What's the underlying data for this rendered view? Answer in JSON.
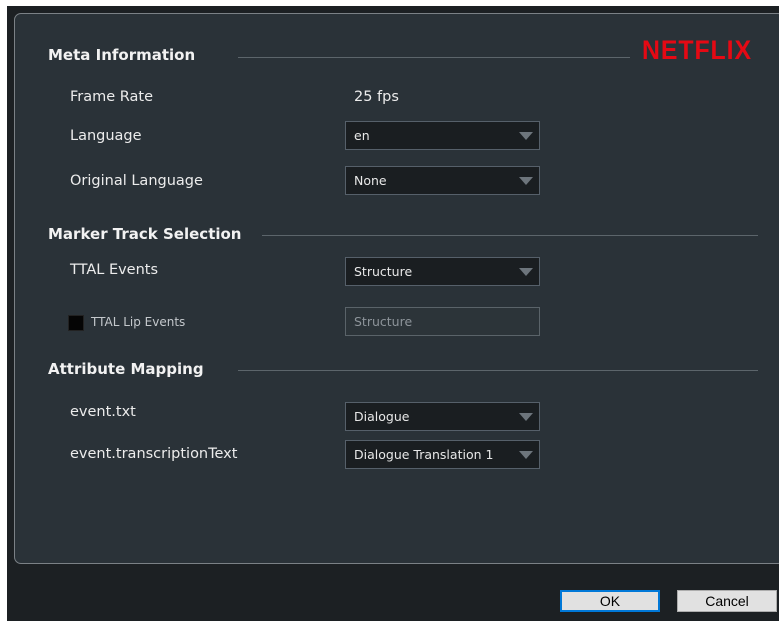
{
  "brand": {
    "logo_text": "NETFLIX",
    "logo_color": "#e50914"
  },
  "meta": {
    "title": "Meta Information",
    "frame_rate": {
      "label": "Frame Rate",
      "value": "25 fps"
    },
    "language": {
      "label": "Language",
      "value": "en"
    },
    "original_language": {
      "label": "Original Language",
      "value": "None"
    }
  },
  "marker": {
    "title": "Marker Track Selection",
    "ttal_events": {
      "label": "TTAL Events",
      "value": "Structure"
    },
    "ttal_lip_events": {
      "label": "TTAL Lip Events",
      "value": "Structure",
      "checked": false
    }
  },
  "mapping": {
    "title": "Attribute Mapping",
    "event_txt": {
      "label": "event.txt",
      "value": "Dialogue"
    },
    "event_transcription": {
      "label": "event.transcriptionText",
      "value": "Dialogue Translation 1"
    }
  },
  "buttons": {
    "ok": "OK",
    "cancel": "Cancel"
  }
}
